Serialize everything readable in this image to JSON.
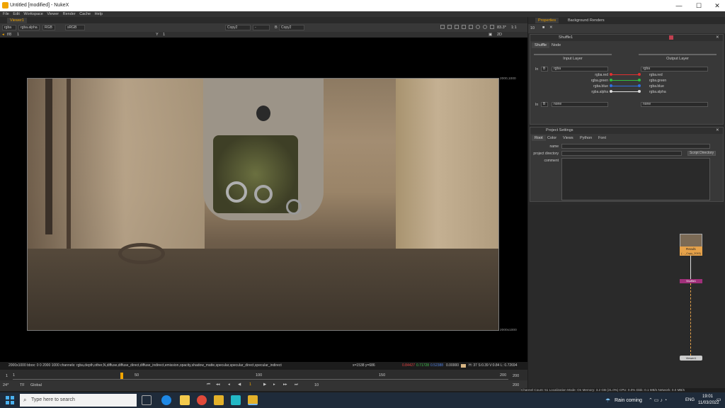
{
  "window": {
    "title": "Untitled [modified] - NukeX",
    "min": "—",
    "max": "☐",
    "close": "✕"
  },
  "menu": [
    "File",
    "Edit",
    "Workspace",
    "Viewer",
    "Render",
    "Cache",
    "Help"
  ],
  "viewer": {
    "tab": "Viewer1",
    "channels": "rgba",
    "channel_sub": "rgba.alpha",
    "colorspace": "RGB",
    "lut": "sRGB",
    "input_a": "Copy2",
    "sep": "-",
    "input_b": "B",
    "input_b_val": "Copy2",
    "frame_label": "f/8",
    "frame_val": "1",
    "y_label": "Y",
    "y_val": "1",
    "zoom": "83.3*",
    "zoom_ratio": "1:1",
    "view_mode": "2D",
    "corner_tr": "2000,1000",
    "corner_br": "2000x1000"
  },
  "infobar": {
    "format": "2000x1000  bbox: 0 0 2000 1000 channels: rgba,depth,other,N,diffuse,diffuse_direct,diffuse_indirect,emission,opacity,shadow_matte,specular,specular_direct,specular_indirect",
    "coords": "x=1538 y=686",
    "r": "0.84427",
    "g": "0.71728",
    "b": "0.52388",
    "a": "0.00000",
    "hsv": "H: 37 S:0.39 V:0.84  L: 0.72694"
  },
  "timeline": {
    "start": "1",
    "end": "200",
    "ticks": [
      "1",
      "50",
      "100",
      "150",
      "200"
    ],
    "fps": "24*",
    "tf": "TF",
    "mode": "Global",
    "step": "10",
    "current": "1"
  },
  "properties": {
    "tab1": "Properties",
    "tab2": "Background Renders",
    "count": "10",
    "shuffle": {
      "name": "Shuffle1",
      "tabs": [
        "Shuffle",
        "Node"
      ],
      "input_layer": "Input Layer",
      "output_layer": "Output Layer",
      "in1_label": "In",
      "in1_b": "B",
      "in1_val": "rgba",
      "out1_val": "rgba",
      "in_channels": [
        "rgba.red",
        "rgba.green",
        "rgba.blue",
        "rgba.alpha"
      ],
      "out_channels": [
        "rgba.red",
        "rgba.green",
        "rgba.blue",
        "rgba.alpha"
      ],
      "in2_label": "In",
      "in2_b": "B",
      "in2_val": "none",
      "out2_val": "none",
      "wire_colors": [
        "#e03030",
        "#30c040",
        "#3070e0",
        "#dddddd"
      ]
    },
    "project": {
      "name": "Project Settings",
      "tabs": [
        "Root",
        "Color",
        "Views",
        "Python",
        "Font"
      ],
      "name_label": "name",
      "dir_label": "project directory",
      "dir_button": "Script Directory",
      "comment_label": "comment"
    }
  },
  "nodegraph": {
    "read": "Read1",
    "read_sub": "(…_Copy_2015)",
    "shuffle": "Shuffle1",
    "viewer": "Viewer1"
  },
  "status": "Channel Count: 51  Localization Mode: On  Memory: 3.2 GB (21.0%)  CPU: 0.0%  Disk: 0.1 MB/s  Network: 0.0 MB/s",
  "taskbar": {
    "search": "Type here to search",
    "weather": "Rain coming",
    "lang": "ENG",
    "time": "19:01",
    "date": "11/03/2022"
  }
}
